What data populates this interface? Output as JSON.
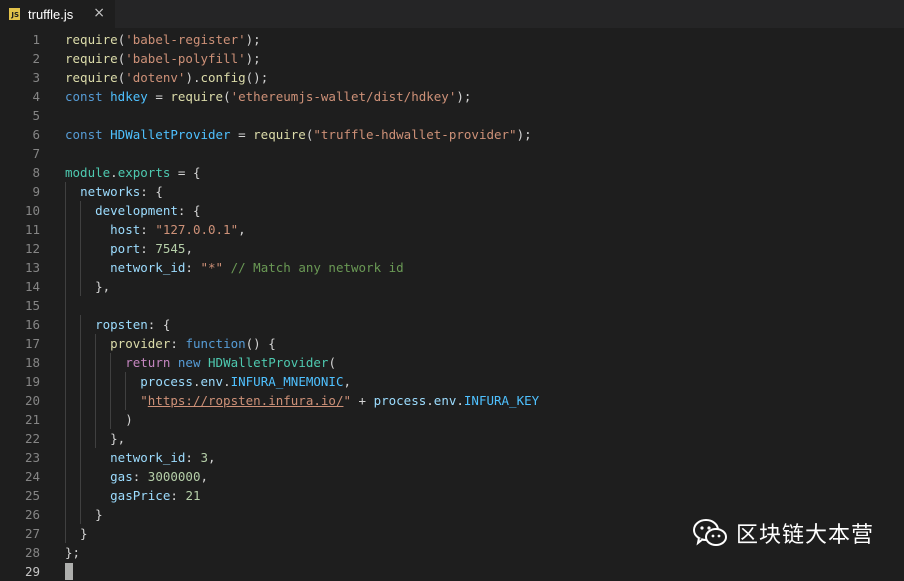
{
  "tab": {
    "title": "truffle.js",
    "icon": "JS",
    "close": "×"
  },
  "watermark": {
    "text": "区块链大本营"
  },
  "lines": [
    {
      "n": "1",
      "tokens": [
        [
          "fn",
          "require"
        ],
        [
          "",
          "("
        ],
        [
          "str",
          "'babel-register'"
        ],
        [
          "",
          ");"
        ]
      ]
    },
    {
      "n": "2",
      "tokens": [
        [
          "fn",
          "require"
        ],
        [
          "",
          "("
        ],
        [
          "str",
          "'babel-polyfill'"
        ],
        [
          "",
          ");"
        ]
      ]
    },
    {
      "n": "3",
      "tokens": [
        [
          "fn",
          "require"
        ],
        [
          "",
          "("
        ],
        [
          "str",
          "'dotenv'"
        ],
        [
          "",
          ")."
        ],
        [
          "fn",
          "config"
        ],
        [
          "",
          "();"
        ]
      ]
    },
    {
      "n": "4",
      "tokens": [
        [
          "kw",
          "const "
        ],
        [
          "con",
          "hdkey"
        ],
        [
          "",
          " = "
        ],
        [
          "fn",
          "require"
        ],
        [
          "",
          "("
        ],
        [
          "str",
          "'ethereumjs-wallet/dist/hdkey'"
        ],
        [
          "",
          ");"
        ]
      ]
    },
    {
      "n": "5",
      "tokens": []
    },
    {
      "n": "6",
      "tokens": [
        [
          "kw",
          "const "
        ],
        [
          "con",
          "HDWalletProvider"
        ],
        [
          "",
          " = "
        ],
        [
          "fn",
          "require"
        ],
        [
          "",
          "("
        ],
        [
          "str",
          "\"truffle-hdwallet-provider\""
        ],
        [
          "",
          ");"
        ]
      ]
    },
    {
      "n": "7",
      "tokens": []
    },
    {
      "n": "8",
      "tokens": [
        [
          "cls",
          "module"
        ],
        [
          "",
          "."
        ],
        [
          "cls",
          "exports"
        ],
        [
          "",
          " = {"
        ]
      ]
    },
    {
      "n": "9",
      "tokens": [
        [
          "",
          "  "
        ],
        [
          "var",
          "networks"
        ],
        [
          "",
          ": {"
        ]
      ]
    },
    {
      "n": "10",
      "tokens": [
        [
          "",
          "    "
        ],
        [
          "var",
          "development"
        ],
        [
          "",
          ": {"
        ]
      ]
    },
    {
      "n": "11",
      "tokens": [
        [
          "",
          "      "
        ],
        [
          "var",
          "host"
        ],
        [
          "",
          ": "
        ],
        [
          "str",
          "\"127.0.0.1\""
        ],
        [
          "",
          ","
        ]
      ]
    },
    {
      "n": "12",
      "tokens": [
        [
          "",
          "      "
        ],
        [
          "var",
          "port"
        ],
        [
          "",
          ": "
        ],
        [
          "num",
          "7545"
        ],
        [
          "",
          ","
        ]
      ]
    },
    {
      "n": "13",
      "tokens": [
        [
          "",
          "      "
        ],
        [
          "var",
          "network_id"
        ],
        [
          "",
          ": "
        ],
        [
          "str",
          "\"*\""
        ],
        [
          "",
          " "
        ],
        [
          "cm",
          "// Match any network id"
        ]
      ]
    },
    {
      "n": "14",
      "tokens": [
        [
          "",
          "    },"
        ]
      ]
    },
    {
      "n": "15",
      "tokens": []
    },
    {
      "n": "16",
      "tokens": [
        [
          "",
          "    "
        ],
        [
          "var",
          "ropsten"
        ],
        [
          "",
          ": {"
        ]
      ]
    },
    {
      "n": "17",
      "tokens": [
        [
          "",
          "      "
        ],
        [
          "fn",
          "provider"
        ],
        [
          "",
          ": "
        ],
        [
          "kw",
          "function"
        ],
        [
          "",
          "() {"
        ]
      ]
    },
    {
      "n": "18",
      "tokens": [
        [
          "",
          "        "
        ],
        [
          "ctl",
          "return "
        ],
        [
          "kw",
          "new "
        ],
        [
          "cls",
          "HDWalletProvider"
        ],
        [
          "",
          "("
        ]
      ]
    },
    {
      "n": "19",
      "tokens": [
        [
          "",
          "          "
        ],
        [
          "var",
          "process"
        ],
        [
          "",
          "."
        ],
        [
          "var",
          "env"
        ],
        [
          "",
          "."
        ],
        [
          "con",
          "INFURA_MNEMONIC"
        ],
        [
          "",
          ","
        ]
      ]
    },
    {
      "n": "20",
      "tokens": [
        [
          "",
          "          "
        ],
        [
          "str",
          "\""
        ],
        [
          "str link",
          "https://ropsten.infura.io/"
        ],
        [
          "str",
          "\""
        ],
        [
          "",
          " + "
        ],
        [
          "var",
          "process"
        ],
        [
          "",
          "."
        ],
        [
          "var",
          "env"
        ],
        [
          "",
          "."
        ],
        [
          "con",
          "INFURA_KEY"
        ]
      ]
    },
    {
      "n": "21",
      "tokens": [
        [
          "",
          "        )"
        ]
      ]
    },
    {
      "n": "22",
      "tokens": [
        [
          "",
          "      },"
        ]
      ]
    },
    {
      "n": "23",
      "tokens": [
        [
          "",
          "      "
        ],
        [
          "var",
          "network_id"
        ],
        [
          "",
          ": "
        ],
        [
          "num",
          "3"
        ],
        [
          "",
          ","
        ]
      ]
    },
    {
      "n": "24",
      "tokens": [
        [
          "",
          "      "
        ],
        [
          "var",
          "gas"
        ],
        [
          "",
          ": "
        ],
        [
          "num",
          "3000000"
        ],
        [
          "",
          ","
        ]
      ]
    },
    {
      "n": "25",
      "tokens": [
        [
          "",
          "      "
        ],
        [
          "var",
          "gasPrice"
        ],
        [
          "",
          ": "
        ],
        [
          "num",
          "21"
        ]
      ]
    },
    {
      "n": "26",
      "tokens": [
        [
          "",
          "    }"
        ]
      ]
    },
    {
      "n": "27",
      "tokens": [
        [
          "",
          "  }"
        ]
      ]
    },
    {
      "n": "28",
      "tokens": [
        [
          "",
          "};"
        ]
      ]
    },
    {
      "n": "29",
      "tokens": []
    }
  ]
}
